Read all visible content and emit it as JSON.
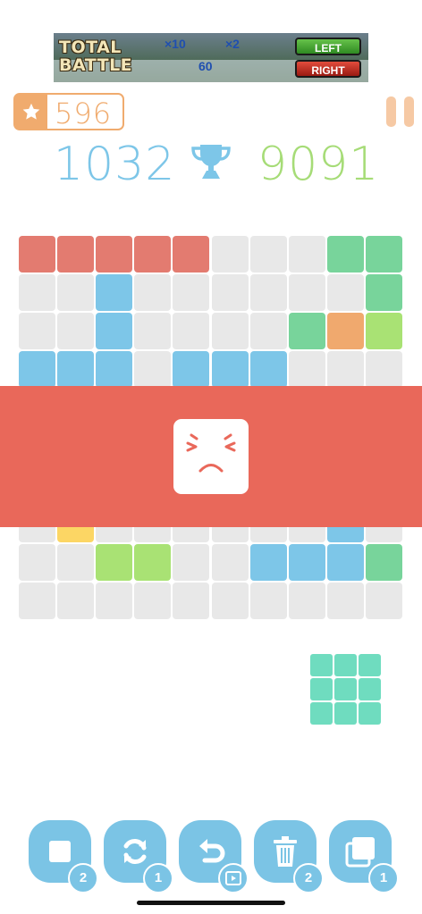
{
  "ad": {
    "logo_line1": "TOTAL",
    "logo_line2": "BATTLE",
    "mult_a": "×10",
    "mult_b": "×2",
    "count": "60",
    "left_label": "LEFT",
    "right_label": "RIGHT"
  },
  "header": {
    "stars": "596",
    "score": "1032",
    "best_score": "9091"
  },
  "colors": {
    "red": "#e37b70",
    "green": "#78d49b",
    "blue": "#7dc6e8",
    "orange": "#f0a96e",
    "lime": "#a9e274",
    "yellow": "#fcd664",
    "empty": "#e8e8e8",
    "banner": "#e9685a",
    "piece": "#6fdcbf"
  },
  "board": {
    "rows": [
      [
        "red",
        "red",
        "red",
        "red",
        "red",
        "empty",
        "empty",
        "empty",
        "green",
        "green"
      ],
      [
        "empty",
        "empty",
        "blue",
        "empty",
        "empty",
        "empty",
        "empty",
        "empty",
        "empty",
        "green"
      ],
      [
        "empty",
        "empty",
        "blue",
        "empty",
        "empty",
        "empty",
        "empty",
        "green",
        "orange",
        "lime"
      ],
      [
        "blue",
        "blue",
        "blue",
        "empty",
        "blue",
        "blue",
        "blue",
        "empty",
        "empty",
        "empty"
      ],
      [
        "empty",
        "empty",
        "empty",
        "empty",
        "empty",
        "empty",
        "empty",
        "empty",
        "empty",
        "empty"
      ],
      [
        "empty",
        "empty",
        "empty",
        "empty",
        "empty",
        "empty",
        "empty",
        "empty",
        "empty",
        "empty"
      ],
      [
        "empty",
        "empty",
        "empty",
        "empty",
        "empty",
        "empty",
        "empty",
        "empty",
        "empty",
        "empty"
      ],
      [
        "empty",
        "yellow",
        "empty",
        "empty",
        "empty",
        "empty",
        "empty",
        "empty",
        "blue",
        "empty"
      ],
      [
        "empty",
        "empty",
        "lime",
        "lime",
        "empty",
        "empty",
        "blue",
        "blue",
        "blue",
        "green"
      ],
      [
        "empty",
        "empty",
        "empty",
        "empty",
        "empty",
        "empty",
        "empty",
        "empty",
        "empty",
        "empty"
      ]
    ]
  },
  "game_over": {
    "face_icon": "sad-face-icon"
  },
  "next_piece": {
    "shape": "3x3-square",
    "color": "#6fdcbf"
  },
  "toolbar": {
    "items": [
      {
        "icon": "single-block-icon",
        "count": "2"
      },
      {
        "icon": "rotate-icon",
        "count": "1"
      },
      {
        "icon": "undo-icon",
        "count": "video-icon"
      },
      {
        "icon": "trash-icon",
        "count": "2"
      },
      {
        "icon": "layers-icon",
        "count": "1"
      }
    ]
  }
}
